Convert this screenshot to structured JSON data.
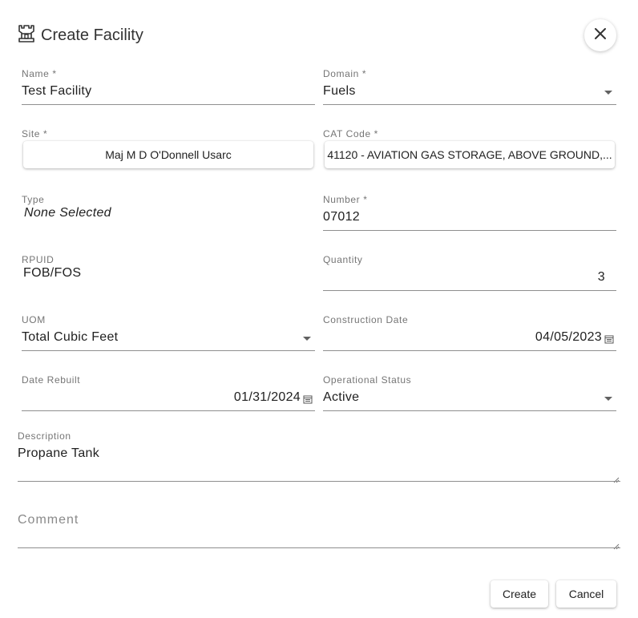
{
  "dialog": {
    "title": "Create Facility",
    "title_icon": "castle-icon",
    "close_icon": "close-icon"
  },
  "fields": {
    "name": {
      "label": "Name *",
      "value": "Test Facility"
    },
    "domain": {
      "label": "Domain *",
      "value": "Fuels"
    },
    "site": {
      "label": "Site *",
      "value": "Maj M D O'Donnell Usarc"
    },
    "cat_code": {
      "label": "CAT Code *",
      "value": "41120 - AVIATION GAS STORAGE, ABOVE GROUND,..."
    },
    "type": {
      "label": "Type",
      "value": "None Selected"
    },
    "number": {
      "label": "Number *",
      "value": "07012"
    },
    "rpuid": {
      "label": "RPUID",
      "value": "FOB/FOS"
    },
    "quantity": {
      "label": "Quantity",
      "value": "3"
    },
    "uom": {
      "label": "UOM",
      "value": "Total Cubic Feet"
    },
    "construction_date": {
      "label": "Construction Date",
      "value": "04/05/2023"
    },
    "date_rebuilt": {
      "label": "Date Rebuilt",
      "value": "01/31/2024"
    },
    "operational_status": {
      "label": "Operational Status",
      "value": "Active"
    },
    "description": {
      "label": "Description",
      "value": "Propane Tank"
    },
    "comment": {
      "placeholder": "Comment"
    }
  },
  "actions": {
    "create_label": "Create",
    "cancel_label": "Cancel"
  }
}
